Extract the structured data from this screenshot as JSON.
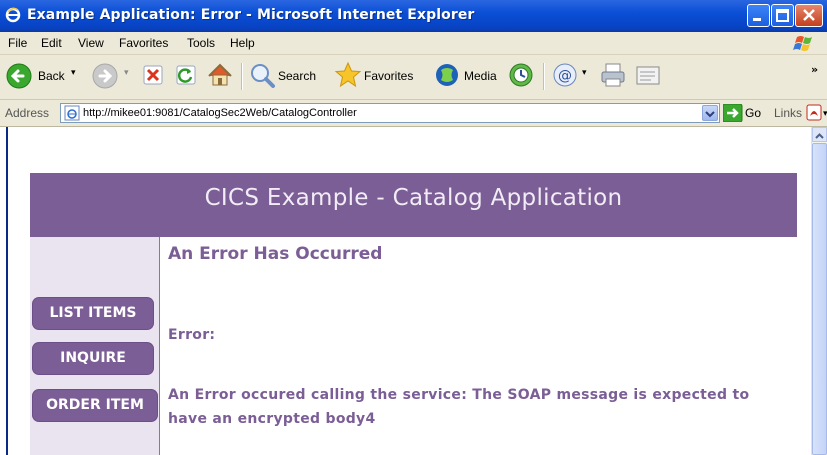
{
  "window": {
    "title": "Example Application: Error - Microsoft Internet Explorer"
  },
  "menubar": {
    "items": [
      "File",
      "Edit",
      "View",
      "Favorites",
      "Tools",
      "Help"
    ]
  },
  "toolbar": {
    "back_label": "Back",
    "search_label": "Search",
    "favorites_label": "Favorites",
    "media_label": "Media"
  },
  "address": {
    "label": "Address",
    "url": "http://mikee01:9081/CatalogSec2Web/CatalogController",
    "go_label": "Go",
    "links_label": "Links"
  },
  "page": {
    "header_title": "CICS Example - Catalog Application",
    "nav": [
      "LIST ITEMS",
      "INQUIRE",
      "ORDER ITEM"
    ],
    "heading": "An Error Has Occurred",
    "error_label": "Error:",
    "error_message": "An Error occured calling the service: The SOAP message is expected to have an encrypted body4"
  },
  "colors": {
    "accent": "#7b5e96",
    "sidebar_bg": "#eae3f0",
    "titlebar": "#0a4fd6",
    "chrome": "#ece9d8"
  }
}
